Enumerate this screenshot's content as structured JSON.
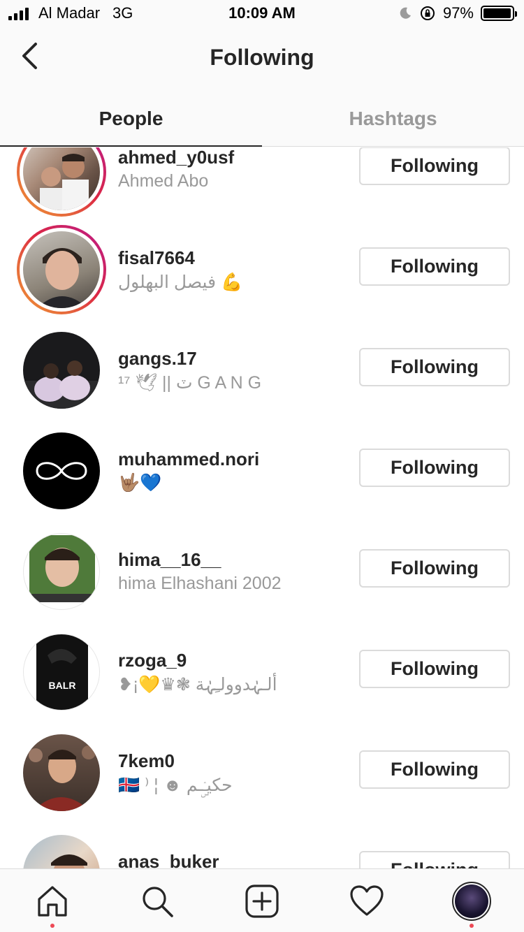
{
  "status_bar": {
    "carrier": "Al Madar",
    "network": "3G",
    "time": "10:09 AM",
    "battery": "97%",
    "battery_level": 0.97
  },
  "header": {
    "title": "Following",
    "back_icon": "chevron-left-icon"
  },
  "tabs": [
    {
      "label": "People",
      "active": true
    },
    {
      "label": "Hashtags",
      "active": false
    }
  ],
  "users": [
    {
      "username": "ahmed_y0usf",
      "fullname": "Ahmed Abo",
      "button": "Following",
      "story_ring": true
    },
    {
      "username": "fisal7664",
      "fullname": "فيصل البهلول 💪",
      "button": "Following",
      "story_ring": true
    },
    {
      "username": "gangs.17",
      "fullname": "ٽ || 🕊 ¹⁷ G A N G",
      "button": "Following",
      "story_ring": false
    },
    {
      "username": "muhammed.nori",
      "fullname": "🤟🏽💙",
      "button": "Following",
      "story_ring": false
    },
    {
      "username": "hima__16__",
      "fullname": "hima Elhashani 2002",
      "button": "Following",
      "story_ring": false
    },
    {
      "username": "rzoga_9",
      "fullname": "❥︎¡💛♛❃ ألـہٰدوولـِہٰة",
      "button": "Following",
      "story_ring": false
    },
    {
      "username": "7kem0",
      "fullname": "🇮🇸 ⁾ ¦ ☻ حكيـۣۛـم",
      "button": "Following",
      "story_ring": false
    },
    {
      "username": "anas_buker",
      "fullname": "",
      "button": "Following",
      "story_ring": false
    }
  ],
  "tabbar": {
    "items": [
      "home-icon",
      "search-icon",
      "add-post-icon",
      "heart-icon",
      "profile-icon"
    ]
  },
  "colors": {
    "text_primary": "#262626",
    "text_secondary": "#999999",
    "border": "#dbdbdb",
    "notification_dot": "#ed4956"
  }
}
